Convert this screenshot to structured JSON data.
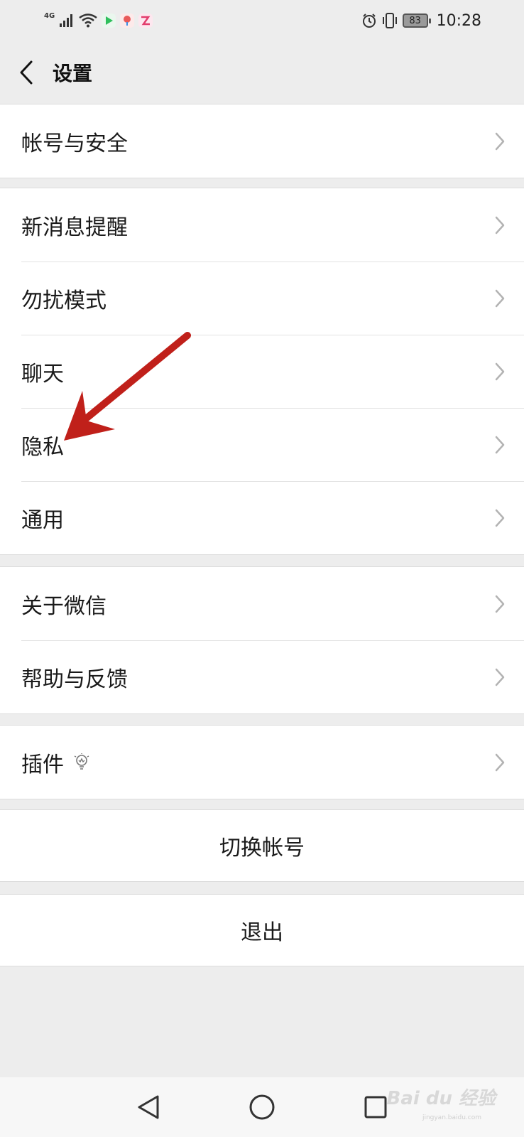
{
  "status_bar": {
    "network": "4G",
    "battery": "83",
    "time": "10:28",
    "icons": [
      "signal-icon",
      "wifi-icon",
      "app-play-icon",
      "app-map-icon",
      "app-video-icon",
      "alarm-icon",
      "vibrate-icon",
      "battery-icon"
    ]
  },
  "header": {
    "title": "设置",
    "back_icon": "chevron-left-icon"
  },
  "groups": [
    {
      "items": [
        {
          "label": "帐号与安全"
        }
      ]
    },
    {
      "items": [
        {
          "label": "新消息提醒"
        },
        {
          "label": "勿扰模式"
        },
        {
          "label": "聊天"
        },
        {
          "label": "隐私"
        },
        {
          "label": "通用"
        }
      ]
    },
    {
      "items": [
        {
          "label": "关于微信"
        },
        {
          "label": "帮助与反馈"
        }
      ]
    },
    {
      "items": [
        {
          "label": "插件",
          "icon": "lightbulb-icon"
        }
      ]
    }
  ],
  "actions": {
    "switch_account": "切换帐号",
    "logout": "退出"
  },
  "annotation": {
    "color": "#c0201a",
    "icon": "red-arrow-pointer"
  },
  "navbar": {
    "icons": [
      "back-triangle-icon",
      "home-circle-icon",
      "recents-square-icon"
    ]
  },
  "watermark": {
    "text": "Bai du 经验",
    "sub": "jingyan.baidu.com"
  }
}
